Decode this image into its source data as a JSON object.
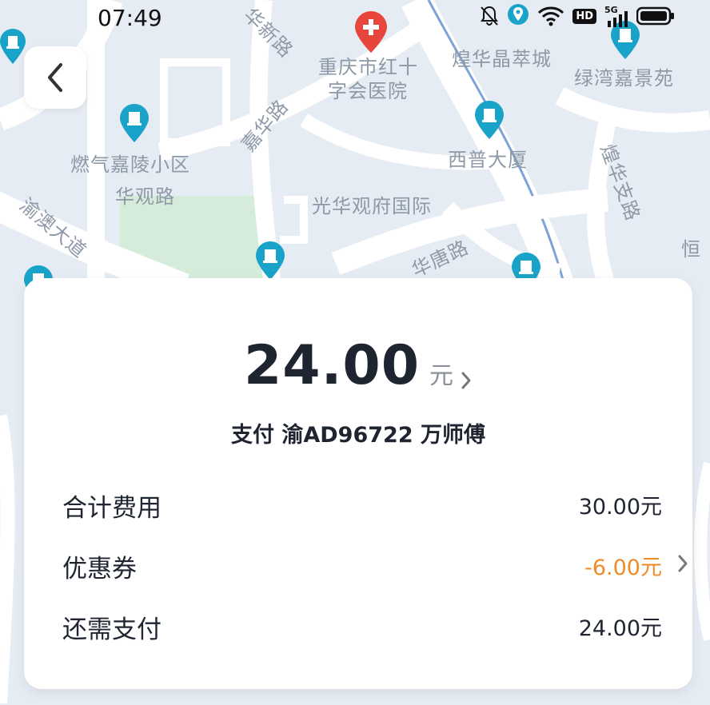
{
  "status_bar": {
    "time": "07:49",
    "hd_label": "HD",
    "network_label": "5G",
    "icons": [
      "bell-off-icon",
      "location-icon",
      "wifi-icon",
      "signal-icon",
      "battery-icon"
    ]
  },
  "map": {
    "labels": [
      "华新路",
      "重庆市红十",
      "字会医院",
      "煌华晶萃城",
      "绿湾嘉景苑",
      "嘉华路",
      "燃气嘉陵小区",
      "华观路",
      "西普大厦",
      "煌华支路",
      "光华观府国际",
      "渝澳大道",
      "华唐路",
      "恒"
    ],
    "poi_icon": "building-pin-icon",
    "hospital_icon": "hospital-pin-icon"
  },
  "back_button": {
    "icon": "chevron-left-icon"
  },
  "payment": {
    "amount": "24.00",
    "unit": "元",
    "payee": "支付 渝AD96722 万师傅",
    "rows": [
      {
        "label": "合计费用",
        "value": "30.00元"
      },
      {
        "label": "优惠券",
        "value": "-6.00元"
      },
      {
        "label": "还需支付",
        "value": "24.00元"
      }
    ]
  },
  "colors": {
    "accent_orange": "#f08c28",
    "poi_teal": "#1aa3c8",
    "hospital_red": "#e8453c",
    "text_dark": "#1f2530"
  }
}
